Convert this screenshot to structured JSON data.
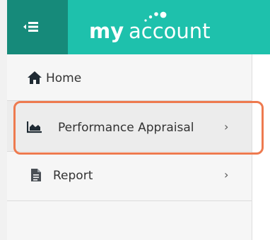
{
  "header": {
    "brand_my": "my",
    "brand_account": "account",
    "menu_toggle_icon": "menu-collapse-icon",
    "colors": {
      "header_bg": "#1ec1ac",
      "toggle_bg": "#168a7a"
    }
  },
  "sidebar": {
    "items": [
      {
        "label": "Home",
        "icon": "home-icon",
        "has_chevron": false
      },
      {
        "label": "Performance Appraisal",
        "icon": "area-chart-icon",
        "has_chevron": true,
        "chevron": "›"
      },
      {
        "label": "Report",
        "icon": "document-icon",
        "has_chevron": true,
        "chevron": "›"
      }
    ]
  },
  "highlight": {
    "color": "#ee7a4f"
  }
}
